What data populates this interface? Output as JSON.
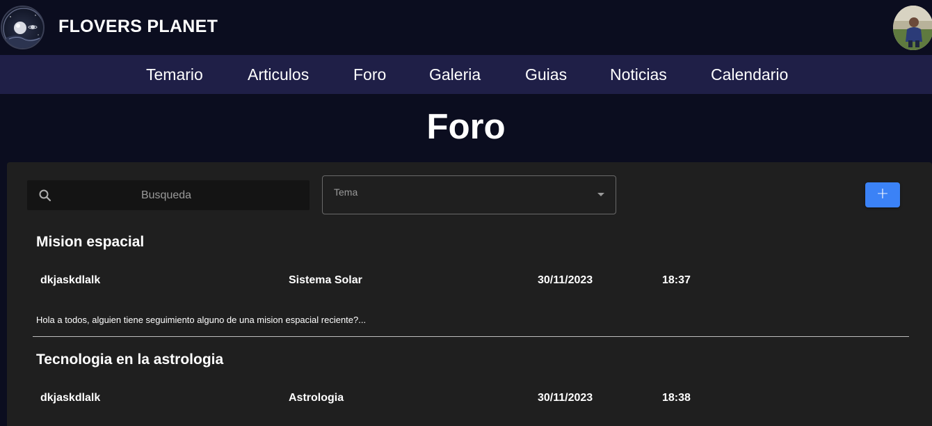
{
  "brand": {
    "name": "FLOVERS PLANET"
  },
  "nav": {
    "items": [
      {
        "label": "Temario"
      },
      {
        "label": "Articulos"
      },
      {
        "label": "Foro"
      },
      {
        "label": "Galeria"
      },
      {
        "label": "Guias"
      },
      {
        "label": "Noticias"
      },
      {
        "label": "Calendario"
      }
    ]
  },
  "page": {
    "title": "Foro"
  },
  "filters": {
    "search_placeholder": "Busqueda",
    "topic_label": "Tema",
    "add_label": "+"
  },
  "posts": [
    {
      "title": "Mision espacial",
      "author": "dkjaskdlalk",
      "topic": "Sistema Solar",
      "date": "30/11/2023",
      "time": "18:37",
      "excerpt": "Hola a todos, alguien tiene seguimiento alguno de una mision espacial reciente?..."
    },
    {
      "title": "Tecnologia en la astrologia",
      "author": "dkjaskdlalk",
      "topic": "Astrologia",
      "date": "30/11/2023",
      "time": "18:38"
    }
  ],
  "colors": {
    "header_bg": "#0b0d1f",
    "nav_bg": "#1f1f47",
    "panel_bg": "#1f1f1f",
    "accent": "#3b82f6"
  },
  "icons": {
    "logo": "planet-logo-icon",
    "search": "search-icon",
    "dropdown": "chevron-down-icon",
    "avatar": "user-avatar"
  }
}
